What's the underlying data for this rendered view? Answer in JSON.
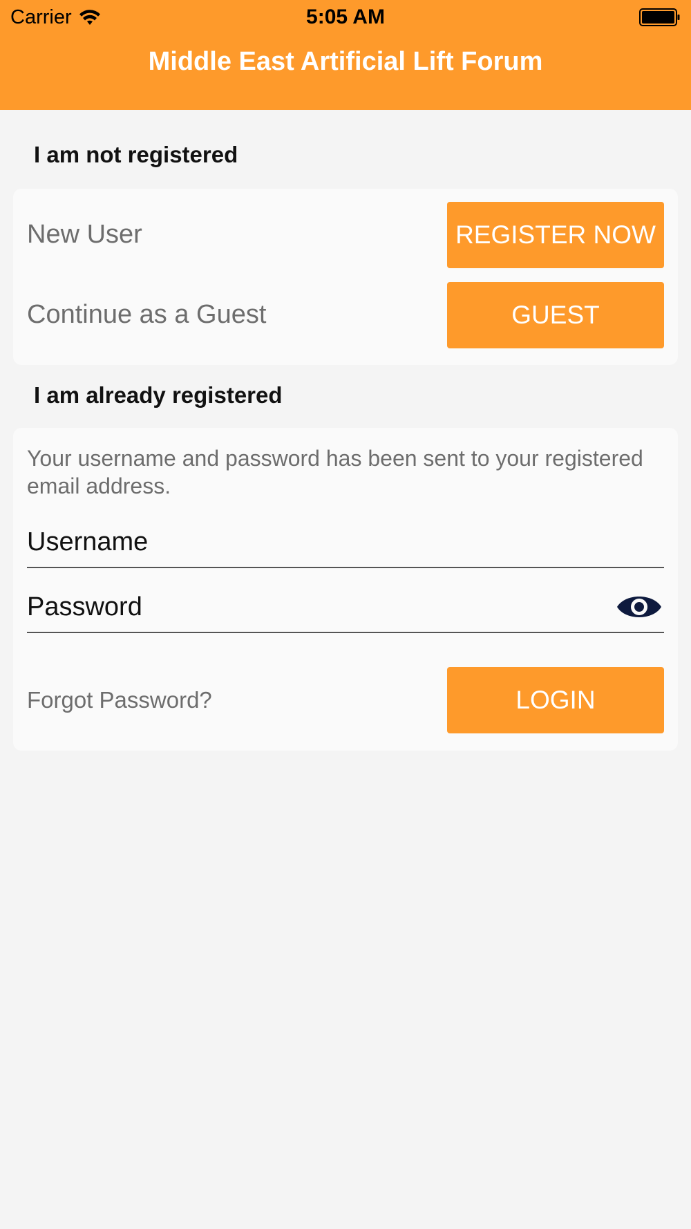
{
  "status_bar": {
    "carrier": "Carrier",
    "time": "5:05 AM"
  },
  "header": {
    "title": "Middle East Artificial Lift Forum",
    "color": "#fe9a2b"
  },
  "not_registered": {
    "heading": "I am not registered",
    "new_user_label": "New User",
    "register_button": "REGISTER NOW",
    "guest_label": "Continue as a Guest",
    "guest_button": "GUEST"
  },
  "registered": {
    "heading": "I am already registered",
    "info": "Your username and password has been sent to your registered email address.",
    "username_placeholder": "Username",
    "password_placeholder": "Password",
    "password_toggle_icon": "eye-icon",
    "forgot_link": "Forgot Password?",
    "login_button": "LOGIN"
  }
}
